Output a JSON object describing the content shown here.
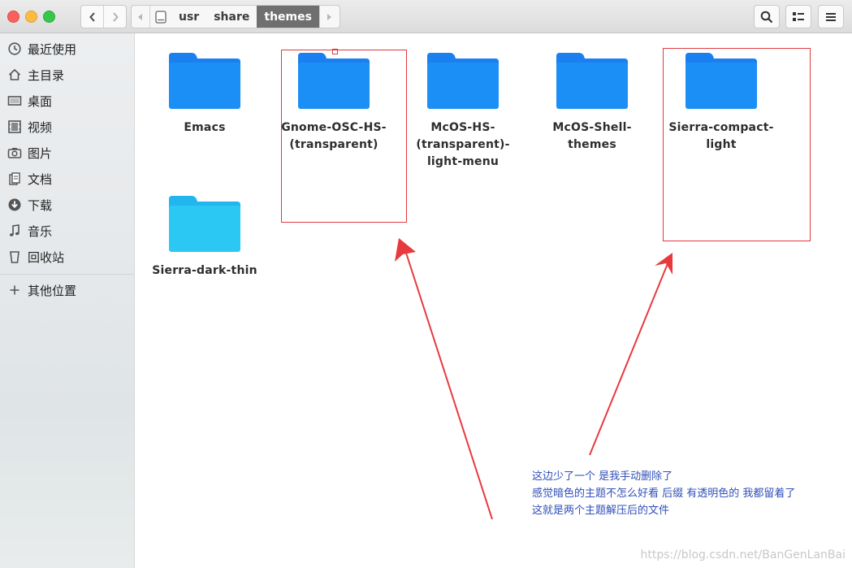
{
  "toolbar": {
    "back_icon": "chevron-left-icon",
    "forward_icon": "chevron-right-icon",
    "path": [
      "usr",
      "share",
      "themes"
    ],
    "active_path": "themes"
  },
  "sidebar": {
    "items": [
      {
        "label": "最近使用",
        "icon": "recent-icon"
      },
      {
        "label": "主目录",
        "icon": "home-icon"
      },
      {
        "label": "桌面",
        "icon": "desktop-icon"
      },
      {
        "label": "视频",
        "icon": "video-icon"
      },
      {
        "label": "图片",
        "icon": "camera-icon"
      },
      {
        "label": "文档",
        "icon": "document-icon"
      },
      {
        "label": "下载",
        "icon": "download-icon"
      },
      {
        "label": "音乐",
        "icon": "music-icon"
      },
      {
        "label": "回收站",
        "icon": "trash-icon"
      }
    ],
    "other": {
      "label": "其他位置",
      "icon": "plus-icon"
    }
  },
  "folders": [
    {
      "name": "Emacs",
      "lines": [
        "Emacs"
      ],
      "color": "#1a8cf6"
    },
    {
      "name": "Gnome-OSC-HS-(transparent)",
      "lines": [
        "Gnome-OSC-HS-",
        "(transparent)"
      ],
      "color": "#1a8cf6"
    },
    {
      "name": "McOS-HS-(transparent)-light-menu",
      "lines": [
        "McOS-HS-",
        "(transparent)-",
        "light-menu"
      ],
      "color": "#1a8cf6"
    },
    {
      "name": "McOS-Shell-themes",
      "lines": [
        "McOS-Shell-",
        "themes"
      ],
      "color": "#1a8cf6"
    },
    {
      "name": "Sierra-compact-light",
      "lines": [
        "Sierra-compact-",
        "light"
      ],
      "color": "#1a8cf6"
    },
    {
      "name": "Sierra-dark-thin",
      "lines": [
        "Sierra-dark-thin"
      ],
      "color": "#29c6f2"
    }
  ],
  "annotation": {
    "lines": [
      "这边少了一个 是我手动删除了",
      "感觉暗色的主题不怎么好看 后缀 有透明色的 我都留着了",
      "这就是两个主题解压后的文件"
    ],
    "color": "#2f4fb8",
    "box_color": "#e0393e"
  },
  "watermark": "https://blog.csdn.net/BanGenLanBai"
}
